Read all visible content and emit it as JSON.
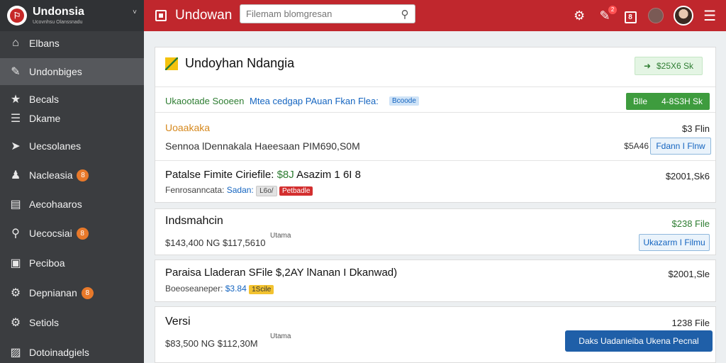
{
  "sidebar": {
    "brand_title": "Undonsia",
    "brand_sub": "Ucovnhsu Olanssnadu",
    "items": [
      {
        "label": "Elbans",
        "icon": "home-icon",
        "glyph": "⌂",
        "badge": ""
      },
      {
        "label": "Undonbiges",
        "icon": "tag-icon",
        "glyph": "✎",
        "badge": "",
        "active": true
      },
      {
        "label": "Becals",
        "icon": "star-icon",
        "glyph": "★",
        "badge": ""
      },
      {
        "label": "Dkame",
        "icon": "list-icon",
        "glyph": "☰",
        "badge": ""
      },
      {
        "label": "Uecsolanes",
        "icon": "label-icon",
        "glyph": "➤",
        "badge": ""
      },
      {
        "label": "Nacleasia",
        "icon": "user-icon",
        "glyph": "♟",
        "badge": "8"
      },
      {
        "label": "Aecohaaros",
        "icon": "document-icon",
        "glyph": "▤",
        "badge": ""
      },
      {
        "label": "Uecocsiai",
        "icon": "search-icon",
        "glyph": "⚲",
        "badge": "8"
      },
      {
        "label": "Peciboa",
        "icon": "terminal-icon",
        "glyph": "▣",
        "badge": ""
      },
      {
        "label": "Depnianan",
        "icon": "gear-icon",
        "glyph": "⚙",
        "badge": "8"
      },
      {
        "label": "Setiols",
        "icon": "settings-icon",
        "glyph": "⚙",
        "badge": ""
      },
      {
        "label": "Dotoinadgiels",
        "icon": "image-icon",
        "glyph": "▨",
        "badge": ""
      }
    ]
  },
  "topbar": {
    "title": "Undowan",
    "search_placeholder": "Filemam blomgresan",
    "notif_badge": "2",
    "box_glyph": "8"
  },
  "main": {
    "card1": {
      "title": "Undoyhan Ndangia",
      "head_pill": "$25X6 Sk",
      "green_row": {
        "text_green": "Ukaootade Sooeen",
        "text_blue": "Mtea cedgap PAuan Fkan Flea:",
        "tag": "Bcoode",
        "btn_left": "Blle",
        "btn_right": "4-8S3H Sk"
      },
      "row2": {
        "title": "Uoaakaka",
        "sub": "Sennoa lDennakala Haeesaan PIM690,S0M",
        "right_top": "$3 Flin",
        "price_prefix": "$5A46",
        "btn": "Fdann I Flnw"
      },
      "row3": {
        "title_a": "Patalse Fimite Ciriefile:",
        "title_price": "$8J",
        "title_b": "Asazim 1 6I 8",
        "sub": "Fenrosanncata:",
        "sub_blue": "Sadan:",
        "tag_gray": "L6o/",
        "tag_red": "Petbadle",
        "right": "$2001,Sk6"
      }
    },
    "card2": {
      "title": "Indsmahcin",
      "meta": "Utama",
      "sub": "$143,400 NG $117,5610",
      "right_top": "$238 File",
      "btn": "Ukazarm I Filmu"
    },
    "card3": {
      "title": "Paraisa Lladeran SFile $,2AY lNanan I Dkanwad)",
      "sub": "Boeoseaneper:",
      "sub_blue": "$3.84",
      "tag": "1Scile",
      "right": "$2001,Sle"
    },
    "card4": {
      "title": "Versi",
      "meta": "Utama",
      "sub": "$83,500 NG $112,30M",
      "right_top": "1238 File",
      "btn": "Daks Uadanieiba Ukena Pecnal"
    }
  },
  "colors": {
    "topbar": "#c0272d",
    "sidebar": "#3b3d40",
    "accent_green": "#2e7d32",
    "accent_blue": "#1565c0"
  }
}
